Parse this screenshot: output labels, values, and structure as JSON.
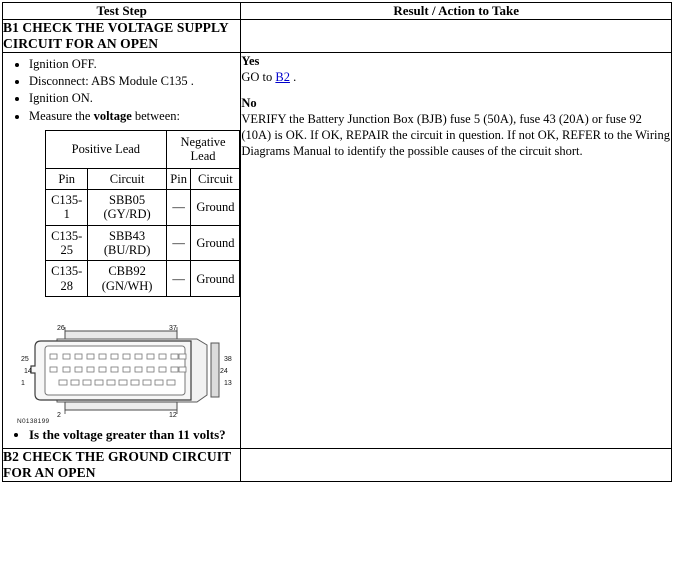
{
  "document": {
    "headers": {
      "test_step": "Test Step",
      "result_action": "Result / Action to Take"
    }
  },
  "b1": {
    "title": "B1 CHECK THE VOLTAGE SUPPLY CIRCUIT FOR AN OPEN",
    "steps": [
      "Ignition OFF.",
      "Disconnect: ABS Module C135 .",
      "Measure the voltage between:"
    ],
    "step_ignition_on": "Ignition ON.",
    "measure_prefix": "Measure the ",
    "measure_bold": "voltage",
    "measure_suffix": " between:",
    "question": "Is the voltage greater than 11 volts?",
    "result": {
      "yes_label": "Yes",
      "yes_prefix": "GO to ",
      "yes_link": "B2",
      "yes_suffix": " .",
      "no_label": "No",
      "no_text": "VERIFY the Battery Junction Box (BJB) fuse 5 (50A), fuse 43 (20A) or fuse 92 (10A) is OK. If OK, REPAIR the circuit in question. If not OK, REFER to the Wiring Diagrams Manual to identify the possible causes of the circuit short."
    },
    "lead_table": {
      "group_positive": "Positive Lead",
      "group_negative": "Negative Lead",
      "col_pin": "Pin",
      "col_circuit": "Circuit",
      "col_neg_pin": "Pin",
      "col_neg_circuit": "Circuit",
      "rows": [
        {
          "pin": "C135-1",
          "circuit": "SBB05",
          "color": "(GY/RD)",
          "neg_pin": "—",
          "neg_circuit": "Ground"
        },
        {
          "pin": "C135-25",
          "circuit": "SBB43",
          "color": "(BU/RD)",
          "neg_pin": "—",
          "neg_circuit": "Ground"
        },
        {
          "pin": "C135-28",
          "circuit": "CBB92",
          "color": "(GN/WH)",
          "neg_pin": "—",
          "neg_circuit": "Ground"
        }
      ]
    },
    "connector": {
      "part_number": "N0138199",
      "pin_labels": {
        "top_left": "26",
        "top_right": "37",
        "left_upper": "25",
        "left_mid": "14",
        "left_lower": "1",
        "right_upper": "38",
        "right_mid": "24",
        "right_lower": "13",
        "bottom_left": "2",
        "bottom_right": "12"
      }
    }
  },
  "b2": {
    "title": "B2 CHECK THE GROUND CIRCUIT FOR AN OPEN"
  }
}
